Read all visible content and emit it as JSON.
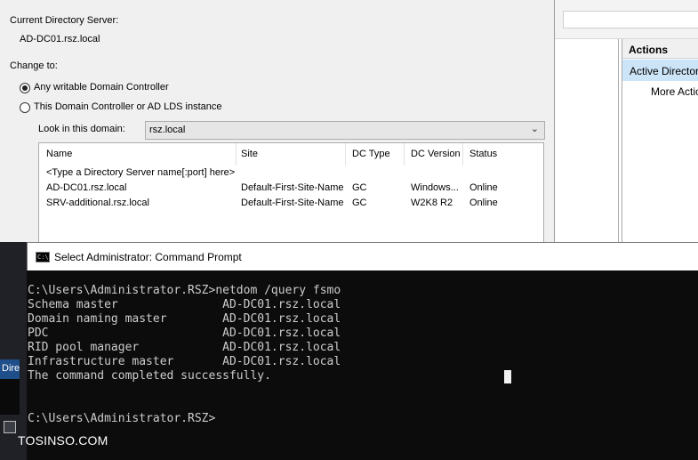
{
  "actions_pane": {
    "header": "Actions",
    "active_item": "Active Directory",
    "more_actions": "More Actions"
  },
  "dialog": {
    "current_server_label": "Current Directory Server:",
    "current_server_value": "AD-DC01.rsz.local",
    "change_to_label": "Change to:",
    "radio_any": "Any writable Domain Controller",
    "radio_this": "This Domain Controller or AD LDS instance",
    "radio_selected": "any",
    "look_in_label": "Look in this domain:",
    "domain_value": "rsz.local",
    "columns": [
      "Name",
      "Site",
      "DC Type",
      "DC Version",
      "Status"
    ],
    "placeholder_row": "<Type a Directory Server name[:port] here>",
    "rows": [
      [
        "AD-DC01.rsz.local",
        "Default-First-Site-Name",
        "GC",
        "Windows...",
        "Online"
      ],
      [
        "SRV-additional.rsz.local",
        "Default-First-Site-Name",
        "GC",
        "W2K8 R2",
        "Online"
      ]
    ]
  },
  "cmd": {
    "title": "Select Administrator: Command Prompt",
    "icon": "cmd-icon",
    "lines": [
      "C:\\Users\\Administrator.RSZ>netdom /query fsmo",
      "Schema master               AD-DC01.rsz.local",
      "Domain naming master        AD-DC01.rsz.local",
      "PDC                         AD-DC01.rsz.local",
      "RID pool manager            AD-DC01.rsz.local",
      "Infrastructure master       AD-DC01.rsz.local",
      "The command completed successfully.",
      "",
      "",
      "C:\\Users\\Administrator.RSZ>"
    ]
  },
  "taskbar_left": {
    "label": "Dire"
  },
  "watermark": "TOSINSO.COM"
}
